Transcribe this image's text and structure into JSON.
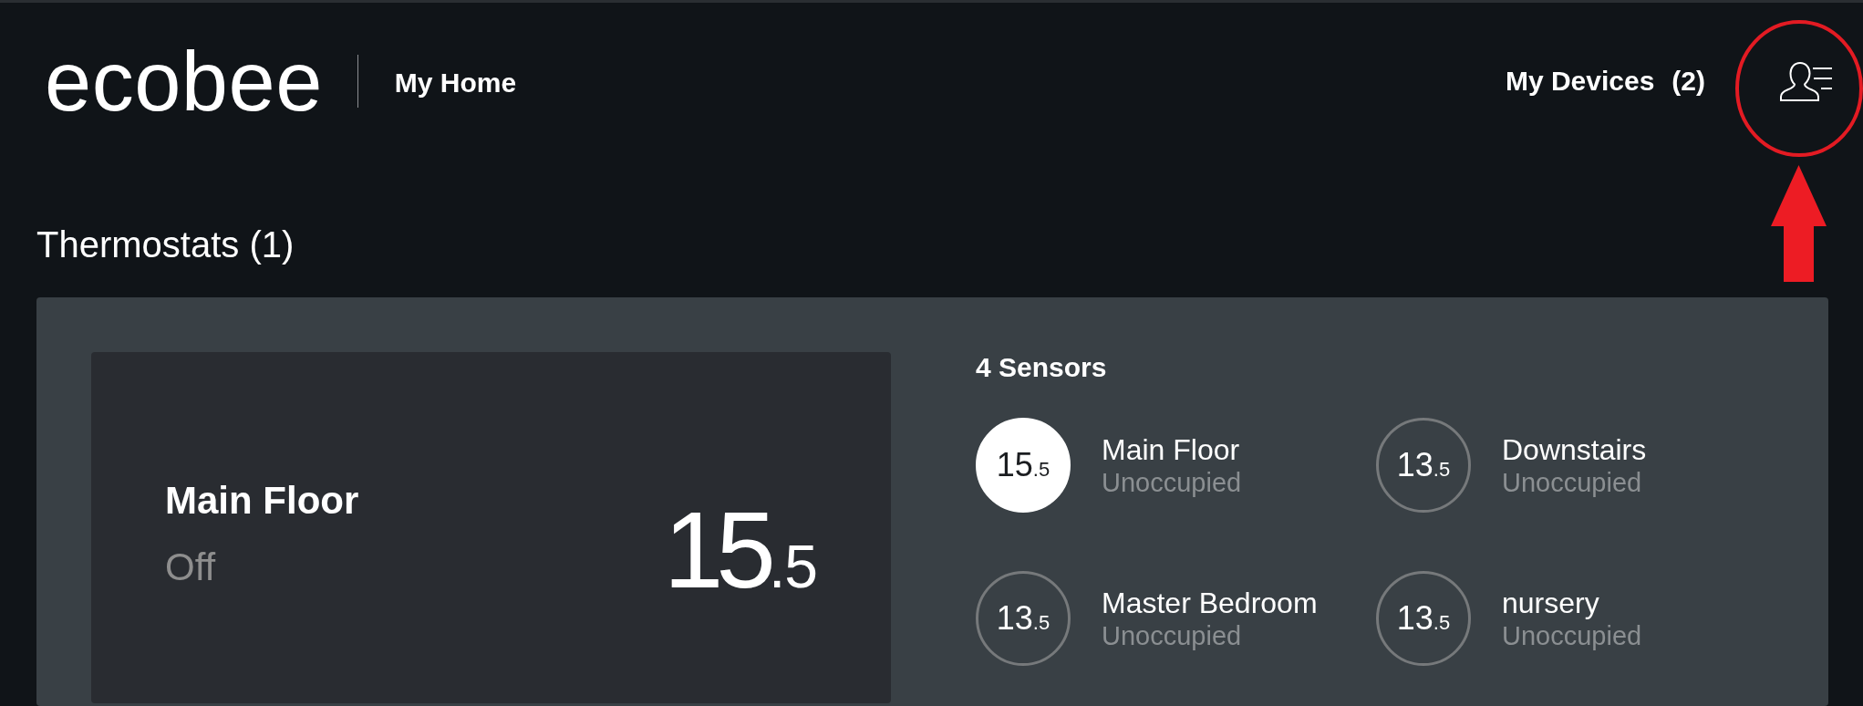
{
  "header": {
    "logo": "ecobee",
    "home_name": "My Home",
    "devices_link": {
      "label": "My Devices",
      "count": "(2)"
    }
  },
  "section_title": "Thermostats (1)",
  "thermostats": [
    {
      "name": "Main Floor",
      "mode": "Off",
      "temperature": "15",
      "temperature_decimal": ".5",
      "sensors_title": "4 Sensors",
      "sensors": [
        {
          "name": "Main Floor",
          "status": "Unoccupied",
          "temperature": "15",
          "temperature_decimal": ".5",
          "selected": true
        },
        {
          "name": "Downstairs",
          "status": "Unoccupied",
          "temperature": "13",
          "temperature_decimal": ".5",
          "selected": false
        },
        {
          "name": "Master Bedroom",
          "status": "Unoccupied",
          "temperature": "13",
          "temperature_decimal": ".5",
          "selected": false
        },
        {
          "name": "nursery",
          "status": "Unoccupied",
          "temperature": "13",
          "temperature_decimal": ".5",
          "selected": false
        }
      ]
    }
  ]
}
